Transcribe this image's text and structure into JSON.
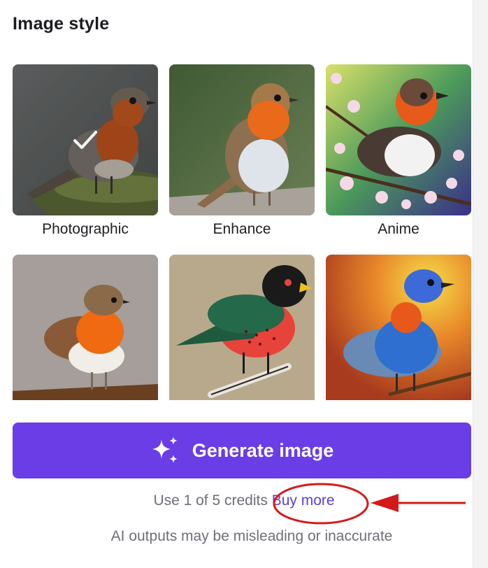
{
  "panel": {
    "title": "Image style"
  },
  "styles": [
    {
      "label": "Photographic",
      "selected": true
    },
    {
      "label": "Enhance",
      "selected": false
    },
    {
      "label": "Anime",
      "selected": false
    },
    {
      "label": "",
      "selected": false
    },
    {
      "label": "",
      "selected": false
    },
    {
      "label": "",
      "selected": false
    }
  ],
  "generate": {
    "label": "Generate image",
    "icon": "sparkle-icon",
    "color": "#6a3de6"
  },
  "credits": {
    "text": "Use 1 of 5 credits",
    "buy_label": "Buy more",
    "link_color": "#5b3fd8"
  },
  "disclaimer": "AI outputs may be misleading or inaccurate",
  "annotation": {
    "color": "#d31a1a"
  }
}
